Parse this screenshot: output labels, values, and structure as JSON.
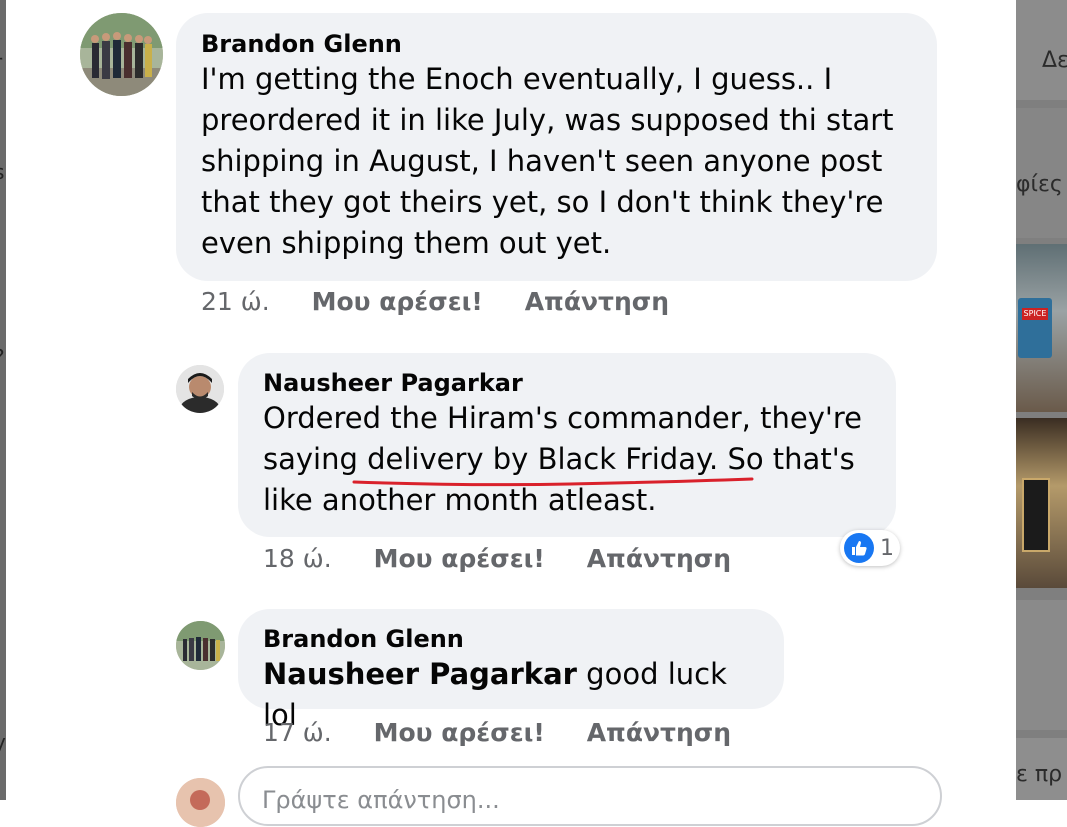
{
  "comments": [
    {
      "author": "Brandon Glenn",
      "lines": [
        "I'm getting the Enoch eventually, I guess.. I",
        "preordered it in like July, was supposed thi start",
        "shipping in August, I haven't seen anyone post",
        "that they got theirs yet, so I don't think they're",
        "even shipping them out yet."
      ],
      "time": "21 ώ.",
      "like_label": "Μου αρέσει!",
      "reply_label": "Απάντηση"
    },
    {
      "author": "Nausheer Pagarkar",
      "lines": [
        "Ordered the Hiram's commander, they're",
        "saying delivery by Black Friday. So that's",
        "like another month atleast."
      ],
      "time": "18 ώ.",
      "like_label": "Μου αρέσει!",
      "reply_label": "Απάντηση",
      "reaction_count": "1",
      "underline_color": "#d9212b"
    },
    {
      "author": "Brandon Glenn",
      "mention": "Nausheer Pagarkar",
      "text": " good luck lol",
      "time": "17 ώ.",
      "like_label": "Μου αρέσει!",
      "reply_label": "Απάντηση"
    }
  ],
  "reply_box": {
    "placeholder": "Γράψτε απάντηση..."
  },
  "background_fragments": {
    "right_top": "Δε",
    "right_mid": "φίες",
    "right_bottom": "ε πρ",
    "package_label": "SPICE"
  },
  "colors": {
    "bubble": "#f0f2f5",
    "meta": "#65676b",
    "like_blue": "#1877f2"
  }
}
